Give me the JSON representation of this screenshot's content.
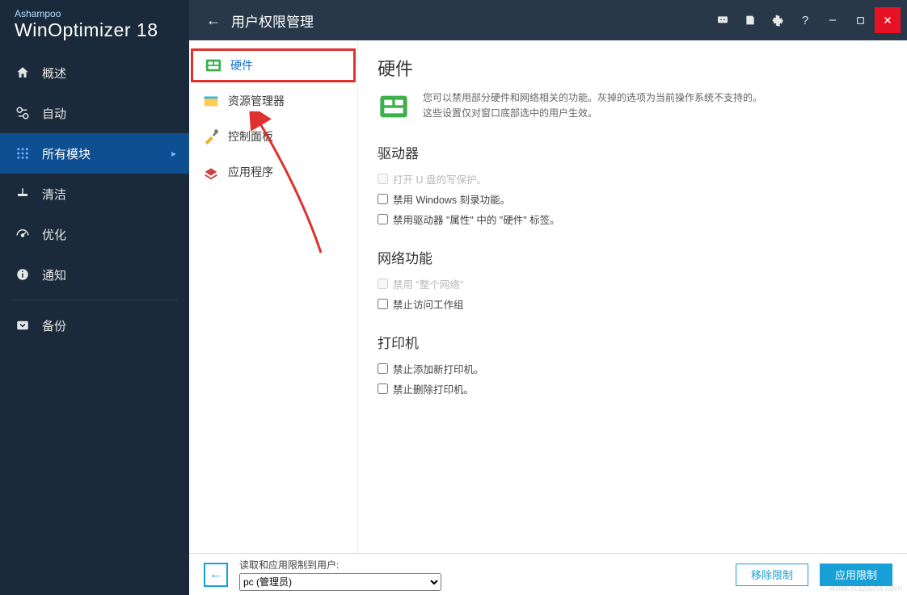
{
  "brand": {
    "company": "Ashampoo",
    "product": "WinOptimizer",
    "version": "18"
  },
  "titlebar": {
    "title": "用户权限管理"
  },
  "nav": {
    "items": [
      {
        "label": "概述",
        "icon": "home-icon"
      },
      {
        "label": "自动",
        "icon": "auto-icon"
      },
      {
        "label": "所有模块",
        "icon": "modules-icon",
        "selected": true
      },
      {
        "label": "清洁",
        "icon": "clean-icon"
      },
      {
        "label": "优化",
        "icon": "optimize-icon"
      },
      {
        "label": "通知",
        "icon": "info-icon"
      },
      {
        "label": "备份",
        "icon": "backup-icon"
      }
    ]
  },
  "categories": {
    "items": [
      {
        "label": "硬件",
        "active": true
      },
      {
        "label": "资源管理器"
      },
      {
        "label": "控制面板"
      },
      {
        "label": "应用程序"
      }
    ]
  },
  "detail": {
    "title": "硬件",
    "desc_line1": "您可以禁用部分硬件和网络相关的功能。灰掉的选项为当前操作系统不支持的。",
    "desc_line2": "这些设置仅对窗口底部选中的用户生效。",
    "groups": [
      {
        "heading": "驱动器",
        "options": [
          {
            "label": "打开 U 盘的写保护。",
            "disabled": true
          },
          {
            "label": "禁用 Windows 刻录功能。"
          },
          {
            "label": "禁用驱动器 \"属性\" 中的 \"硬件\" 标签。"
          }
        ]
      },
      {
        "heading": "网络功能",
        "options": [
          {
            "label": "禁用 \"整个网络\"",
            "disabled": true
          },
          {
            "label": "禁止访问工作组"
          }
        ]
      },
      {
        "heading": "打印机",
        "options": [
          {
            "label": "禁止添加新打印机。"
          },
          {
            "label": "禁止删除打印机。"
          }
        ]
      }
    ]
  },
  "footer": {
    "user_label": "读取和应用限制到用户:",
    "user_selected": "pc (管理员)",
    "remove_btn": "移除限制",
    "apply_btn": "应用限制"
  },
  "watermark": "www.xiazaiba.com"
}
